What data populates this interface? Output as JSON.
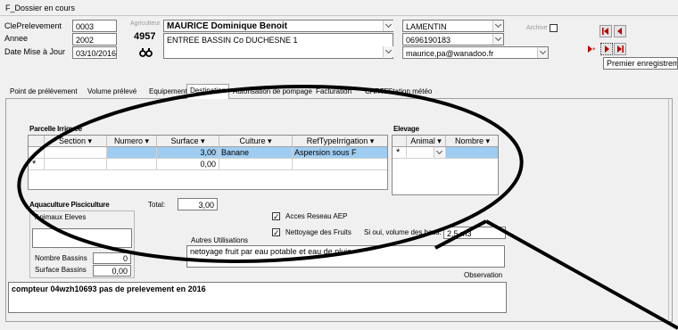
{
  "window": {
    "title": "F_Dossier en cours"
  },
  "header": {
    "cle_label": "ClePrelevement",
    "cle_value": "0003",
    "annee_label": "Annee",
    "annee_value": "2002",
    "date_label": "Date Mise à Jour",
    "date_value": "03/10/2016",
    "agriculteur_label": "Agriculteur",
    "agriculteur_id": "4957",
    "agriculteur_name": "MAURICE Dominique Benoit",
    "address": "ENTREE BASSIN Co DUCHESNE 1",
    "commune": "LAMENTIN",
    "phone": "0696190183",
    "email": "maurice,pa@wanadoo.fr",
    "archive_label": "Archive"
  },
  "nav": {
    "tooltip": "Premier enregistreme"
  },
  "tabs": [
    "Point de prélèvement",
    "Volume prélevé",
    "Equipement",
    "Destination",
    "Autorisation de pompage",
    "Facturation",
    "CARTE",
    "Station météo"
  ],
  "parcelle": {
    "title": "Parcelle Irriguee",
    "columns": [
      "Section",
      "Numero",
      "Surface",
      "Culture",
      "RefTypeIrrigation"
    ],
    "rows": [
      {
        "section": "",
        "numero": "",
        "surface": "3,00",
        "culture": "Banane",
        "irrigation": "Aspersion sous F"
      },
      {
        "section": "",
        "numero": "",
        "surface": "0,00",
        "culture": "",
        "irrigation": ""
      }
    ],
    "total_label": "Total:",
    "total_value": "3,00"
  },
  "elevage": {
    "title": "Elevage",
    "columns": [
      "Animal",
      "Nombre"
    ]
  },
  "aquaculture": {
    "title": "Aquaculture Pisciculture",
    "animaux_label": "Animaux Eleves",
    "bassins_label": "Nombre Bassins",
    "bassins_value": "0",
    "surface_label": "Surface Bassins",
    "surface_value": "0,00"
  },
  "options": {
    "acces_label": "Acces Reseau AEP",
    "nettoyage_label": "Nettoyage des Fruits",
    "volume_label": "Si oui, volume des bacs:",
    "volume_value": "2,5 m3",
    "autres_label": "Autres Utilisations",
    "autres_value": "netoyage fruit par eau potable et eau de pluie",
    "observation_label": "Observation",
    "observation_value": "compteur 04wzh10693 pas de prelevement en 2016"
  }
}
